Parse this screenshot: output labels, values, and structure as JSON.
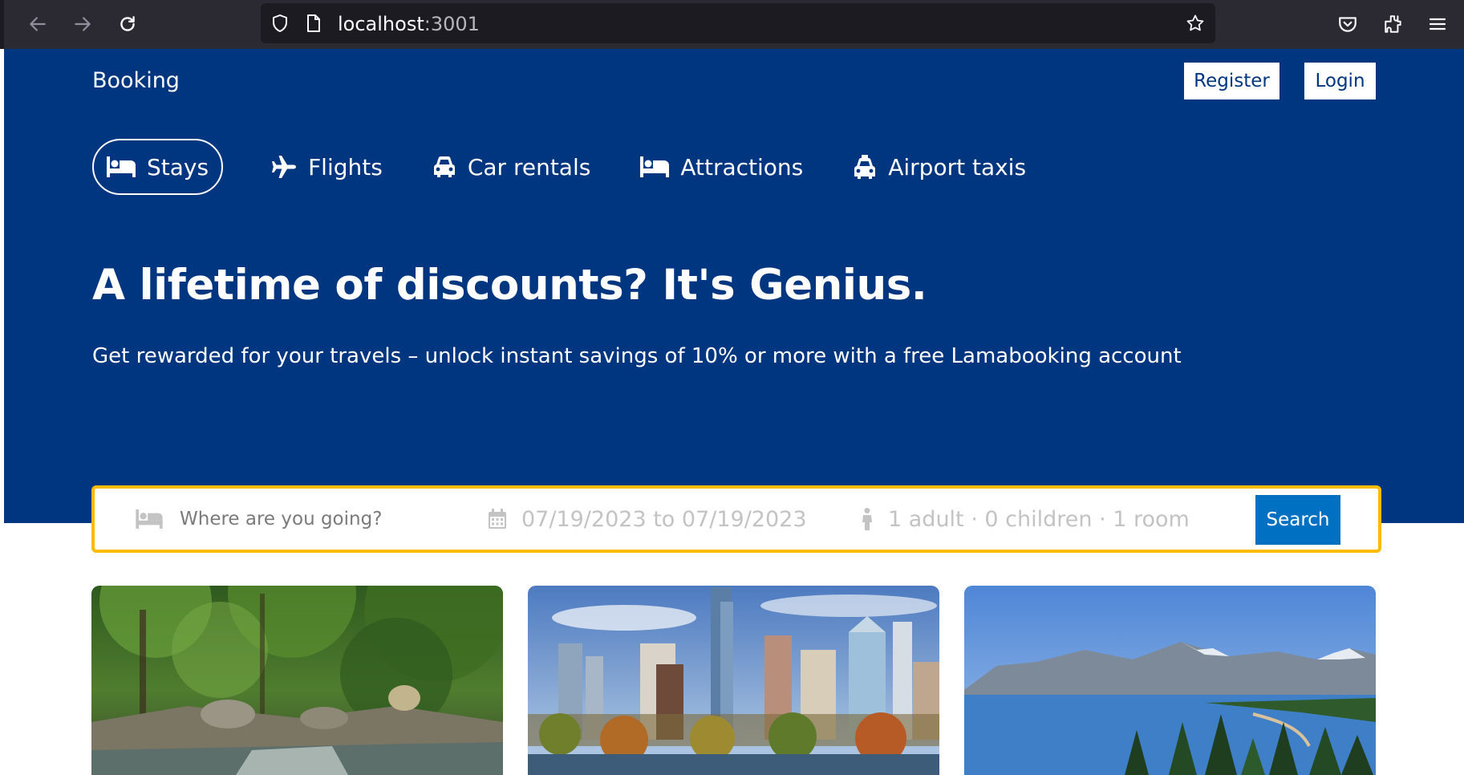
{
  "browser": {
    "url_host": "localhost",
    "url_port": ":3001"
  },
  "header": {
    "brand": "Booking",
    "register_label": "Register",
    "login_label": "Login"
  },
  "nav": {
    "items": [
      {
        "label": "Stays",
        "icon": "bed-icon",
        "active": true
      },
      {
        "label": "Flights",
        "icon": "plane-icon",
        "active": false
      },
      {
        "label": "Car rentals",
        "icon": "car-icon",
        "active": false
      },
      {
        "label": "Attractions",
        "icon": "bed-icon",
        "active": false
      },
      {
        "label": "Airport taxis",
        "icon": "taxi-icon",
        "active": false
      }
    ]
  },
  "hero": {
    "title": "A lifetime of discounts? It's Genius.",
    "description": "Get rewarded for your travels – unlock instant savings of 10% or more with a free Lamabooking account"
  },
  "search": {
    "destination_placeholder": "Where are you going?",
    "dates": "07/19/2023 to 07/19/2023",
    "guests": "1 adult · 0 children · 1 room",
    "button_label": "Search"
  },
  "featured": {
    "cards": [
      {
        "image": "forest-stream"
      },
      {
        "image": "city-skyline"
      },
      {
        "image": "mountain-lake"
      }
    ]
  },
  "colors": {
    "brand_blue": "#003580",
    "search_border": "#febb02",
    "button_blue": "#0071c2"
  }
}
